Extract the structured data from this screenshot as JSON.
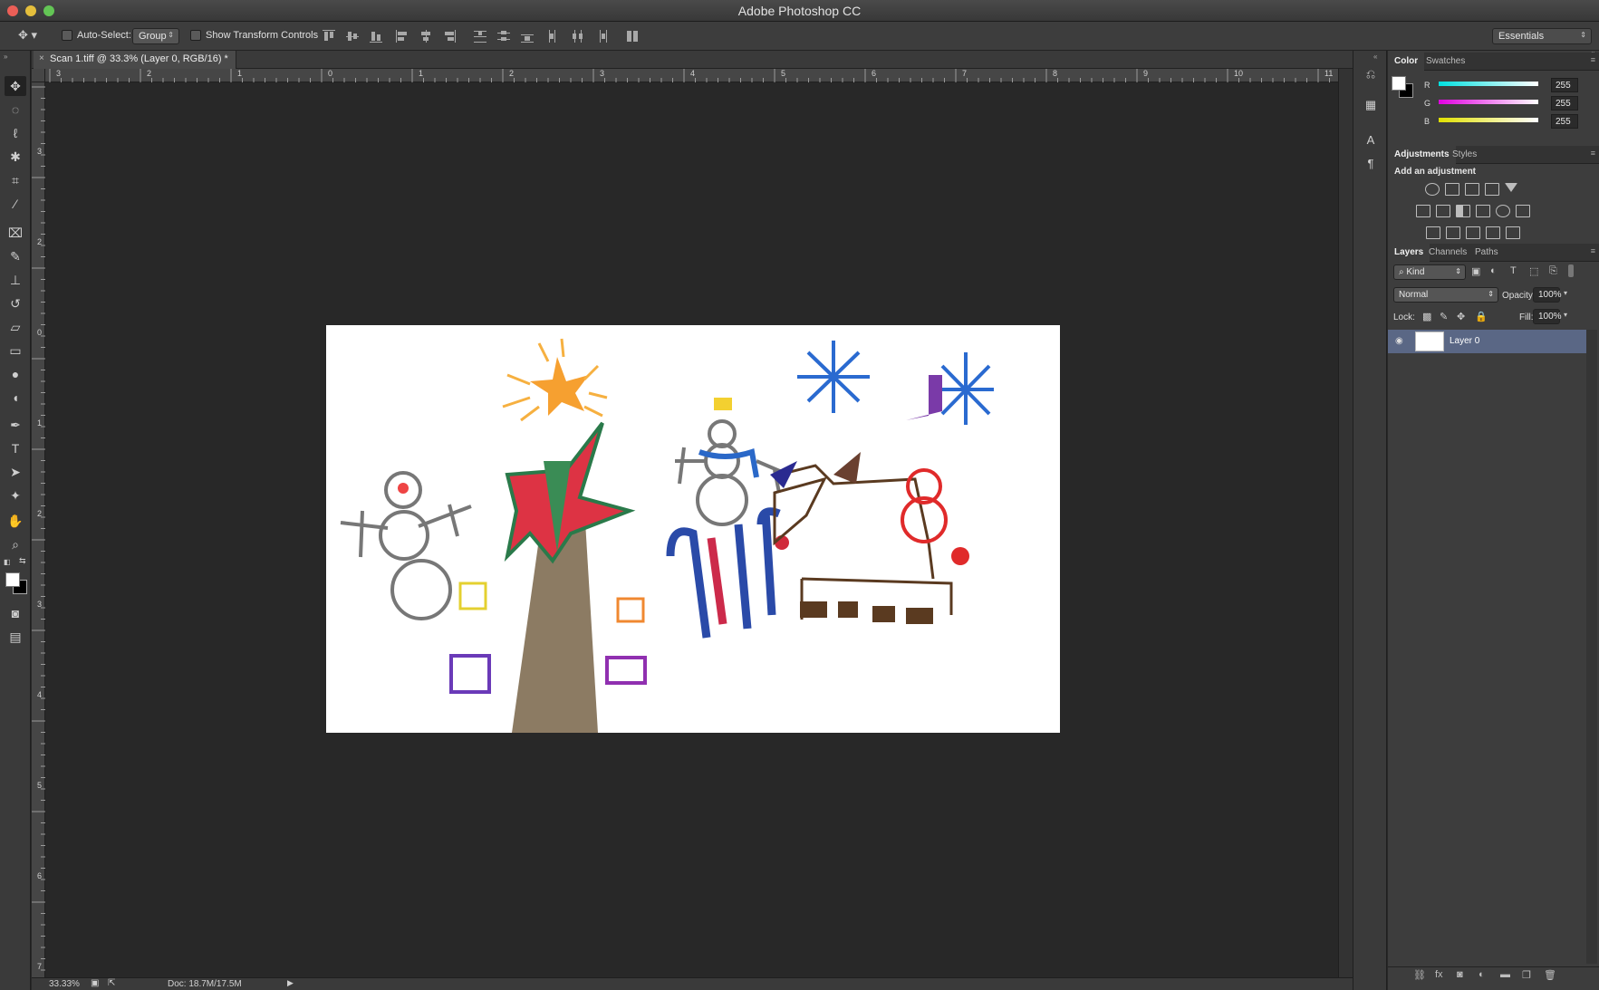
{
  "window": {
    "title": "Adobe Photoshop CC"
  },
  "options_bar": {
    "auto_select_label": "Auto-Select:",
    "auto_select_value": "Group",
    "show_transform_label": "Show Transform Controls",
    "workspace": "Essentials"
  },
  "document": {
    "tab_title": "Scan 1.tiff @ 33.3% (Layer 0, RGB/16) *",
    "close_glyph": "×"
  },
  "rulers": {
    "horizontal": [
      "3",
      "2",
      "1",
      "0",
      "1",
      "2",
      "3",
      "4",
      "5",
      "6",
      "7",
      "8",
      "9",
      "10",
      "11"
    ],
    "vertical": [
      "3",
      "2",
      "1",
      "0",
      "1",
      "2",
      "3",
      "4",
      "5",
      "6",
      "7"
    ]
  },
  "status": {
    "zoom": "33.33%",
    "doc": "Doc: 18.7M/17.5M"
  },
  "color_panel": {
    "tabs": [
      "Color",
      "Swatches"
    ],
    "channels": [
      {
        "label": "R",
        "value": "255"
      },
      {
        "label": "G",
        "value": "255"
      },
      {
        "label": "B",
        "value": "255"
      }
    ]
  },
  "adjustments_panel": {
    "tabs": [
      "Adjustments",
      "Styles"
    ],
    "heading": "Add an adjustment"
  },
  "layers_panel": {
    "tabs": [
      "Layers",
      "Channels",
      "Paths"
    ],
    "filter": "Kind",
    "blend_mode": "Normal",
    "opacity_label": "Opacity:",
    "opacity": "100%",
    "lock_label": "Lock:",
    "fill_label": "Fill:",
    "fill": "100%",
    "layers": [
      {
        "name": "Layer 0"
      }
    ]
  },
  "tools": [
    "move-tool",
    "marquee-tool",
    "lasso-tool",
    "magic-wand-tool",
    "crop-tool",
    "eyedropper-tool",
    "healing-brush-tool",
    "brush-tool",
    "clone-stamp-tool",
    "history-brush-tool",
    "eraser-tool",
    "gradient-tool",
    "blur-tool",
    "dodge-tool",
    "pen-tool",
    "type-tool",
    "path-selection-tool",
    "shape-tool",
    "hand-tool",
    "zoom-tool"
  ],
  "colors": {
    "accent": "#5a6785",
    "background": "#282828",
    "panel": "#3d3d3d"
  }
}
